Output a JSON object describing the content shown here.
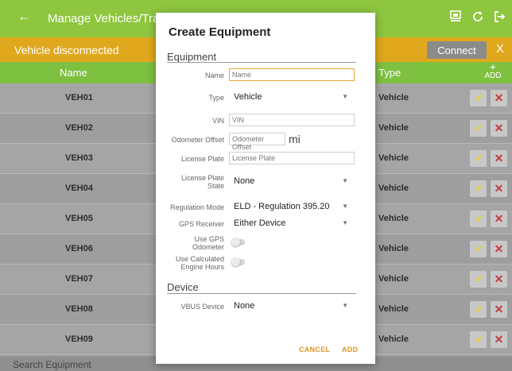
{
  "app": {
    "title": "Manage Vehicles/Trailers",
    "icons": [
      "upload-screen-icon",
      "refresh-icon",
      "logout-icon"
    ]
  },
  "status": {
    "text": "Vehicle disconnected",
    "connect_label": "Connect",
    "close_label": "X"
  },
  "table": {
    "headers": {
      "name": "Name",
      "type": "Type",
      "add": "ADD"
    },
    "rows": [
      {
        "name": "VEH01",
        "type": "Vehicle"
      },
      {
        "name": "VEH02",
        "type": "Vehicle"
      },
      {
        "name": "VEH03",
        "type": "Vehicle"
      },
      {
        "name": "VEH04",
        "type": "Vehicle"
      },
      {
        "name": "VEH05",
        "type": "Vehicle"
      },
      {
        "name": "VEH06",
        "type": "Vehicle"
      },
      {
        "name": "VEH07",
        "type": "Vehicle"
      },
      {
        "name": "VEH08",
        "type": "Vehicle"
      },
      {
        "name": "VEH09",
        "type": "Vehicle"
      }
    ]
  },
  "search": {
    "placeholder": "Search Equipment"
  },
  "dialog": {
    "title": "Create Equipment",
    "section_equipment": "Equipment",
    "section_device": "Device",
    "fields": {
      "name_label": "Name",
      "name_placeholder": "Name",
      "type_label": "Type",
      "type_value": "Vehicle",
      "vin_label": "VIN",
      "vin_placeholder": "VIN",
      "odometer_label": "Odometer Offset",
      "odometer_placeholder": "Odometer Offset",
      "odometer_unit": "mi",
      "plate_label": "License Plate",
      "plate_placeholder": "License Plate",
      "plate_state_label": "License Plate State",
      "plate_state_value": "None",
      "regulation_label": "Regulation Mode",
      "regulation_value": "ELD - Regulation 395.20",
      "gps_label": "GPS Receiver",
      "gps_value": "Either Device",
      "gps_odometer_label": "Use GPS Odometer",
      "engine_hours_label": "Use Calculated Engine Hours",
      "vbus_label": "VBUS Device",
      "vbus_value": "None"
    },
    "cancel_label": "CANCEL",
    "add_label": "ADD"
  },
  "colors": {
    "topbar": "#8ec63f",
    "status": "#e0a81c",
    "header": "#7ec040",
    "accent": "#f0a830",
    "delete": "#c23a3a"
  }
}
